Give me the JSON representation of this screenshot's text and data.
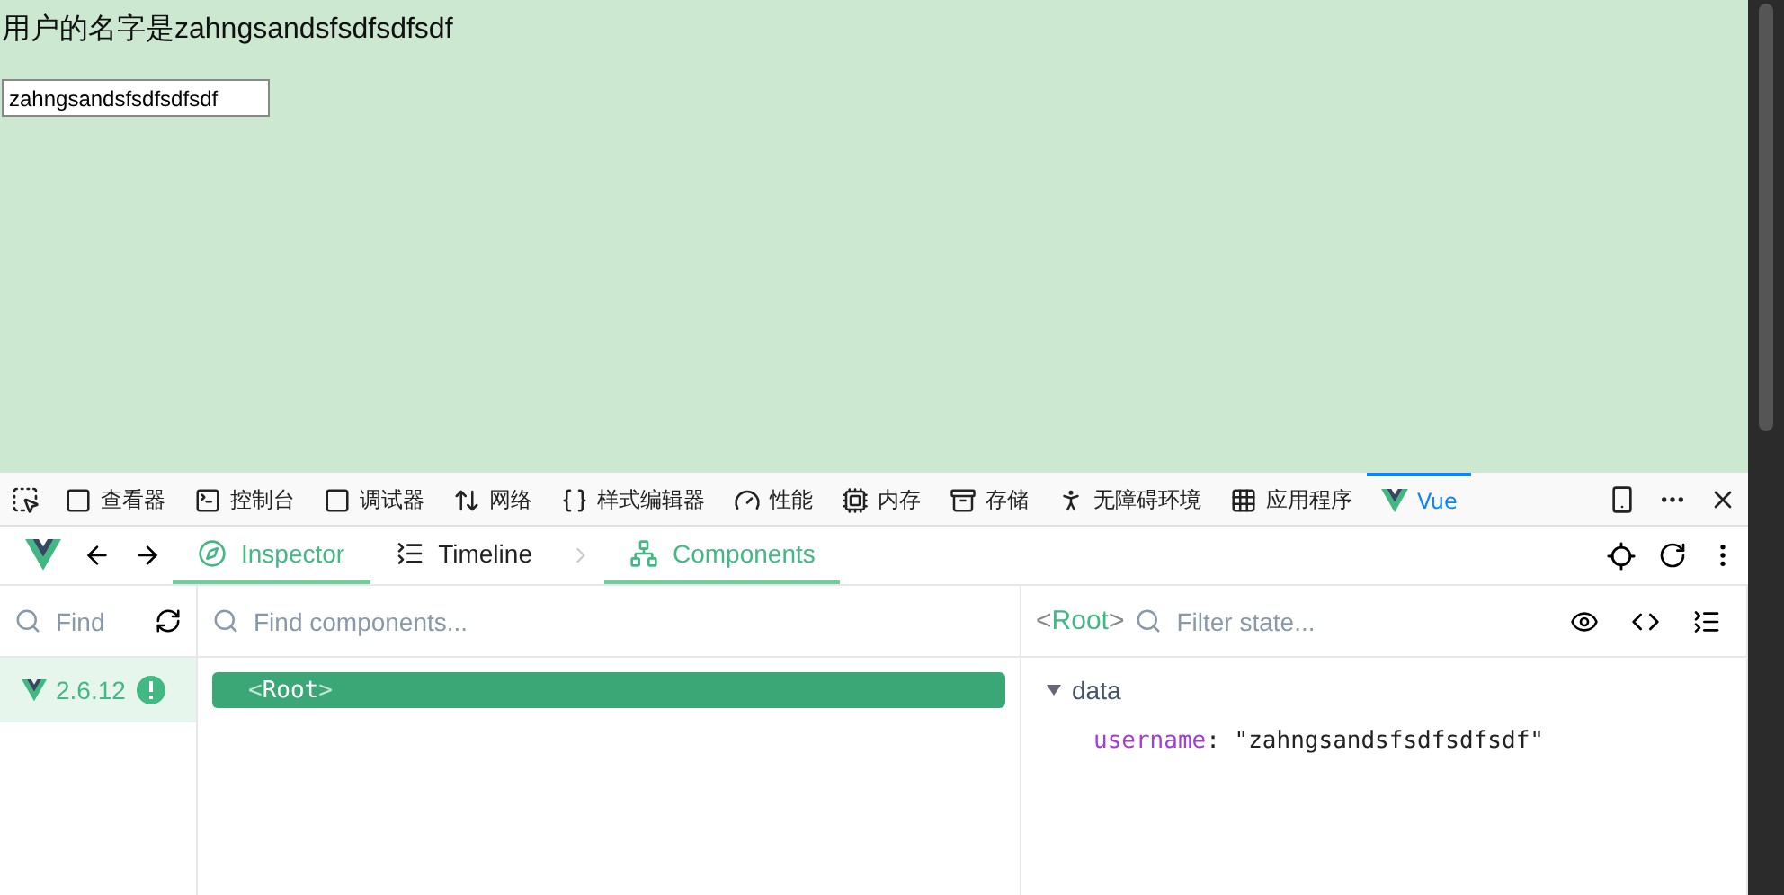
{
  "page": {
    "heading": "用户的名字是zahngsandsfsdfsdfsdf",
    "input_value": "zahngsandsfsdfsdfsdf"
  },
  "devtools_tabs": [
    {
      "label": "查看器",
      "selected": false
    },
    {
      "label": "控制台",
      "selected": false
    },
    {
      "label": "调试器",
      "selected": false
    },
    {
      "label": "网络",
      "selected": false
    },
    {
      "label": "样式编辑器",
      "selected": false
    },
    {
      "label": "性能",
      "selected": false
    },
    {
      "label": "内存",
      "selected": false
    },
    {
      "label": "存储",
      "selected": false
    },
    {
      "label": "无障碍环境",
      "selected": false
    },
    {
      "label": "应用程序",
      "selected": false
    },
    {
      "label": "Vue",
      "selected": true
    }
  ],
  "vue_nav": {
    "tabs": [
      {
        "label": "Inspector",
        "selected": true
      },
      {
        "label": "Timeline",
        "selected": false
      }
    ],
    "subtab": {
      "label": "Components",
      "selected": true
    }
  },
  "apps_panel": {
    "find_placeholder": "Find",
    "apps": [
      {
        "version": "2.6.12",
        "selected": true,
        "warning": true
      }
    ]
  },
  "tree_panel": {
    "placeholder": "Find components...",
    "nodes": [
      {
        "open": "<",
        "name": "Root",
        "close": ">",
        "selected": true
      }
    ]
  },
  "state_panel": {
    "component": {
      "open": "<",
      "name": "Root",
      "close": ">"
    },
    "placeholder": "Filter state...",
    "sections": [
      {
        "title": "data",
        "expanded": true,
        "fields": [
          {
            "key": "username",
            "separator": ": ",
            "value": "\"zahngsandsfsdfsdfsdf\""
          }
        ]
      }
    ]
  }
}
